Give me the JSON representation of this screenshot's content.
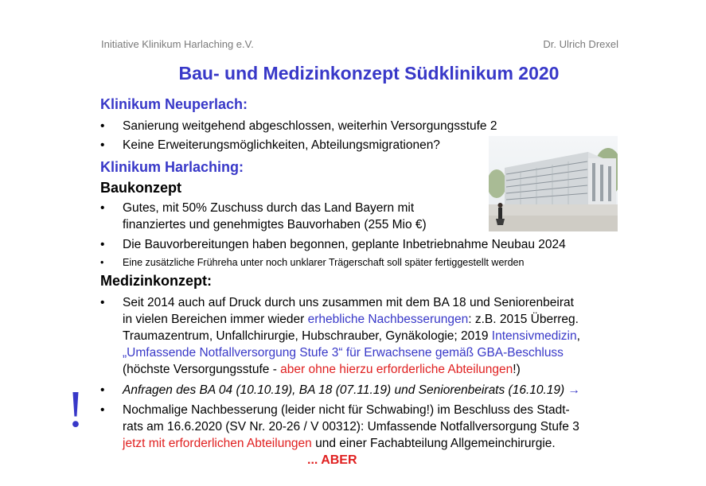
{
  "header": {
    "organization": "Initiative Klinikum Harlaching e.V.",
    "author": "Dr. Ulrich Drexel"
  },
  "title": "Bau- und Medizinkonzept  Südklinikum 2020",
  "neuperlach": {
    "heading": "Klinikum Neuperlach:",
    "bullets": [
      "Sanierung weitgehend abgeschlossen, weiterhin Versorgungsstufe 2",
      "Keine Erweiterungsmöglichkeiten, Abteilungsmigrationen?"
    ]
  },
  "harlaching": {
    "heading": "Klinikum Harlaching:",
    "baukonzept": {
      "heading": "Baukonzept",
      "b1_line1": "Gutes, mit 50% Zuschuss durch das Land Bayern mit",
      "b1_line2": "finanziertes und genehmigtes Bauvorhaben (255 Mio €)",
      "b2": "Die Bauvorbereitungen haben begonnen, geplante Inbetriebnahme Neubau 2024",
      "b3": "Eine zusätzliche Frühreha unter noch unklarer Trägerschaft soll später fertiggestellt werden"
    },
    "medizinkonzept": {
      "heading": "Medizinkonzept:",
      "b1": {
        "l1": "Seit 2014 auch auf Druck durch uns zusammen mit dem BA 18 und Seniorenbeirat",
        "l2_a": "in vielen Bereichen immer wieder ",
        "l2_b": "erhebliche Nachbesserungen",
        "l2_c": ": z.B. 2015 Überreg.",
        "l3_a": "Traumazentrum, Unfallchirurgie, Hubschrauber, Gynäkologie; 2019 ",
        "l3_b": "Intensivmedizin",
        "l3_c": ",",
        "l4": "„Umfassende Notfallversorgung Stufe 3“ für Erwachsene gemäß GBA-Beschluss",
        "l5_a": "(höchste Versorgungsstufe - ",
        "l5_b": "aber ohne hierzu erforderliche Abteilungen",
        "l5_c": "!)"
      },
      "b2_text": "Anfragen des BA 04 (10.10.19), BA 18 (07.11.19) und Seniorenbeirats (16.10.19) ",
      "b2_arrow": "→",
      "b3": {
        "l1": "Nochmalige Nachbesserung (leider nicht für Schwabing!) im Beschluss des Stadt-",
        "l2": "rats am 16.6.2020 (SV Nr. 20-26 / V 00312): Umfassende Notfallversorgung Stufe 3",
        "l3_a": "jetzt mit erforderlichen Abteilungen",
        "l3_b": " und einer Fachabteilung Allgemeinchirurgie."
      }
    }
  },
  "bullet_char": "•",
  "exclamation": "!",
  "aber": "... ABER",
  "colors": {
    "accent_blue": "#3838c8",
    "alert_red": "#e02020",
    "header_gray": "#7a7a7a"
  }
}
